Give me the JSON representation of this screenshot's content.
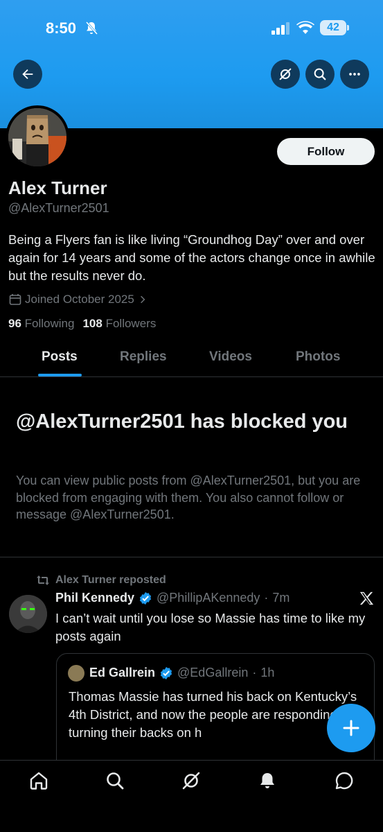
{
  "status_bar": {
    "time": "8:50",
    "battery": "42"
  },
  "profile": {
    "name": "Alex Turner",
    "handle": "@AlexTurner2501",
    "bio": "Being a Flyers fan is like living “Groundhog Day” over and over again for 14 years and some of the actors change once in awhile but the results never do.",
    "joined": "Joined October 2025",
    "following_count": "96",
    "following_label": "Following",
    "followers_count": "108",
    "followers_label": "Followers",
    "follow_label": "Follow"
  },
  "tabs": [
    {
      "label": "Posts",
      "active": true
    },
    {
      "label": "Replies",
      "active": false
    },
    {
      "label": "Videos",
      "active": false
    },
    {
      "label": "Photos",
      "active": false
    }
  ],
  "blocked": {
    "title": "@AlexTurner2501 has blocked you",
    "description": "You can view public posts from @AlexTurner2501, but you are blocked from engaging with them. You also cannot follow or message @AlexTurner2501."
  },
  "post": {
    "repost_label": "Alex Turner reposted",
    "author_name": "Phil Kennedy",
    "author_handle": "@PhillipAKennedy",
    "time": "7m",
    "text": "I can’t wait until you lose so Massie has time to like my posts again",
    "quote": {
      "author_name": "Ed Gallrein",
      "author_handle": "@EdGallrein",
      "time": "1h",
      "text": "Thomas Massie has turned his back on Kentucky’s 4th District, and now the people are responding by turning their backs on h"
    }
  },
  "colors": {
    "accent": "#1d9bf0",
    "background": "#000000",
    "muted_text": "#71767b",
    "primary_text": "#e7e9ea"
  },
  "icons": {
    "top_bar": [
      "back-arrow-icon",
      "grok-icon",
      "search-icon",
      "more-icon"
    ],
    "bottom_nav": [
      "home-icon",
      "search-icon",
      "grok-icon",
      "notifications-icon",
      "messages-icon"
    ]
  }
}
